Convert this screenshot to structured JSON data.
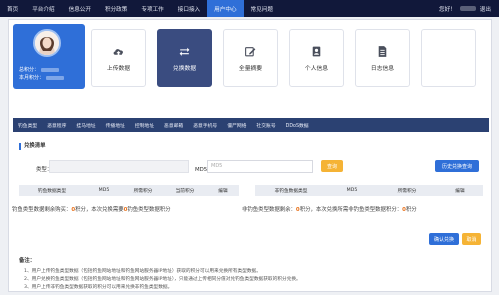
{
  "topnav": {
    "items": [
      "首页",
      "平台介绍",
      "信息公开",
      "积分政策",
      "专项工作",
      "接口接入",
      "用户中心",
      "常见问题"
    ],
    "active_index": 6,
    "greeting": "您好！",
    "logout": "退出"
  },
  "profile": {
    "line1_label": "总积分：",
    "line2_label": "本月积分："
  },
  "tiles": [
    {
      "label": "上传数据",
      "icon": "cloud-upload-icon",
      "active": false
    },
    {
      "label": "兑换数据",
      "icon": "exchange-arrows-icon",
      "active": true
    },
    {
      "label": "全量摘要",
      "icon": "edit-icon",
      "active": false
    },
    {
      "label": "个人信息",
      "icon": "contact-card-icon",
      "active": false
    },
    {
      "label": "日志信息",
      "icon": "document-icon",
      "active": false
    },
    {
      "label": "",
      "icon": "",
      "active": false
    }
  ],
  "subnav": [
    "钓鱼类型",
    "恶意程序",
    "挂马地址",
    "传播地址",
    "控制地址",
    "恶意邮箱",
    "恶意手机号",
    "僵尸网络",
    "社交账号",
    "DDoS数据"
  ],
  "exchange": {
    "section_title": "兑换清单",
    "type_label": "类型：",
    "md5_label": "MD5：",
    "md5_placeholder": "MD5",
    "search_button": "查询",
    "history_button": "历史兑换查询",
    "left_table_headers": [
      "钓鱼数据类型",
      "MD5",
      "所需积分",
      "当前积分",
      "编辑"
    ],
    "right_table_headers": [
      "非钓鱼数据类型",
      "MD5",
      "所需积分",
      "编辑"
    ],
    "left_summary": {
      "p1": "钓鱼类型数据剩余购买：",
      "v1": "0",
      "p2": "积分，本次兑换需要",
      "v2": "0",
      "p3": "钓鱼类型数据积分"
    },
    "right_summary": {
      "p1": "非钓鱼类型数据剩余：",
      "v1": "0",
      "p2": "积分，本次兑换所需非钓鱼类型数据积分：",
      "v2": "0",
      "p3": "积分"
    },
    "confirm_button": "确认兑换",
    "cancel_button": "取消"
  },
  "notes": {
    "title": "备注：",
    "items": [
      "1、用户上传钓鱼类型数据（包括钓鱼网站地址和钓鱼网站服务器IP地址）获取的积分可以用来兑换所有类型数据。",
      "2、用户兑换钓鱼类型数据（包括钓鱼网站地址和钓鱼网站服务器IP地址），只能通过上传相同分值对兑钓鱼类型数据获取的积分兑换。",
      "3、用户上传非钓鱼类型数据获取的积分可以用来兑换非钓鱼类型数据。"
    ]
  },
  "colors": {
    "topbar": "#11183a",
    "accent": "#2f6fd8",
    "subnav": "#2b4172",
    "tile_active": "#3a4c80",
    "orange": "#f5b335",
    "number_highlight": "#e8721c"
  }
}
